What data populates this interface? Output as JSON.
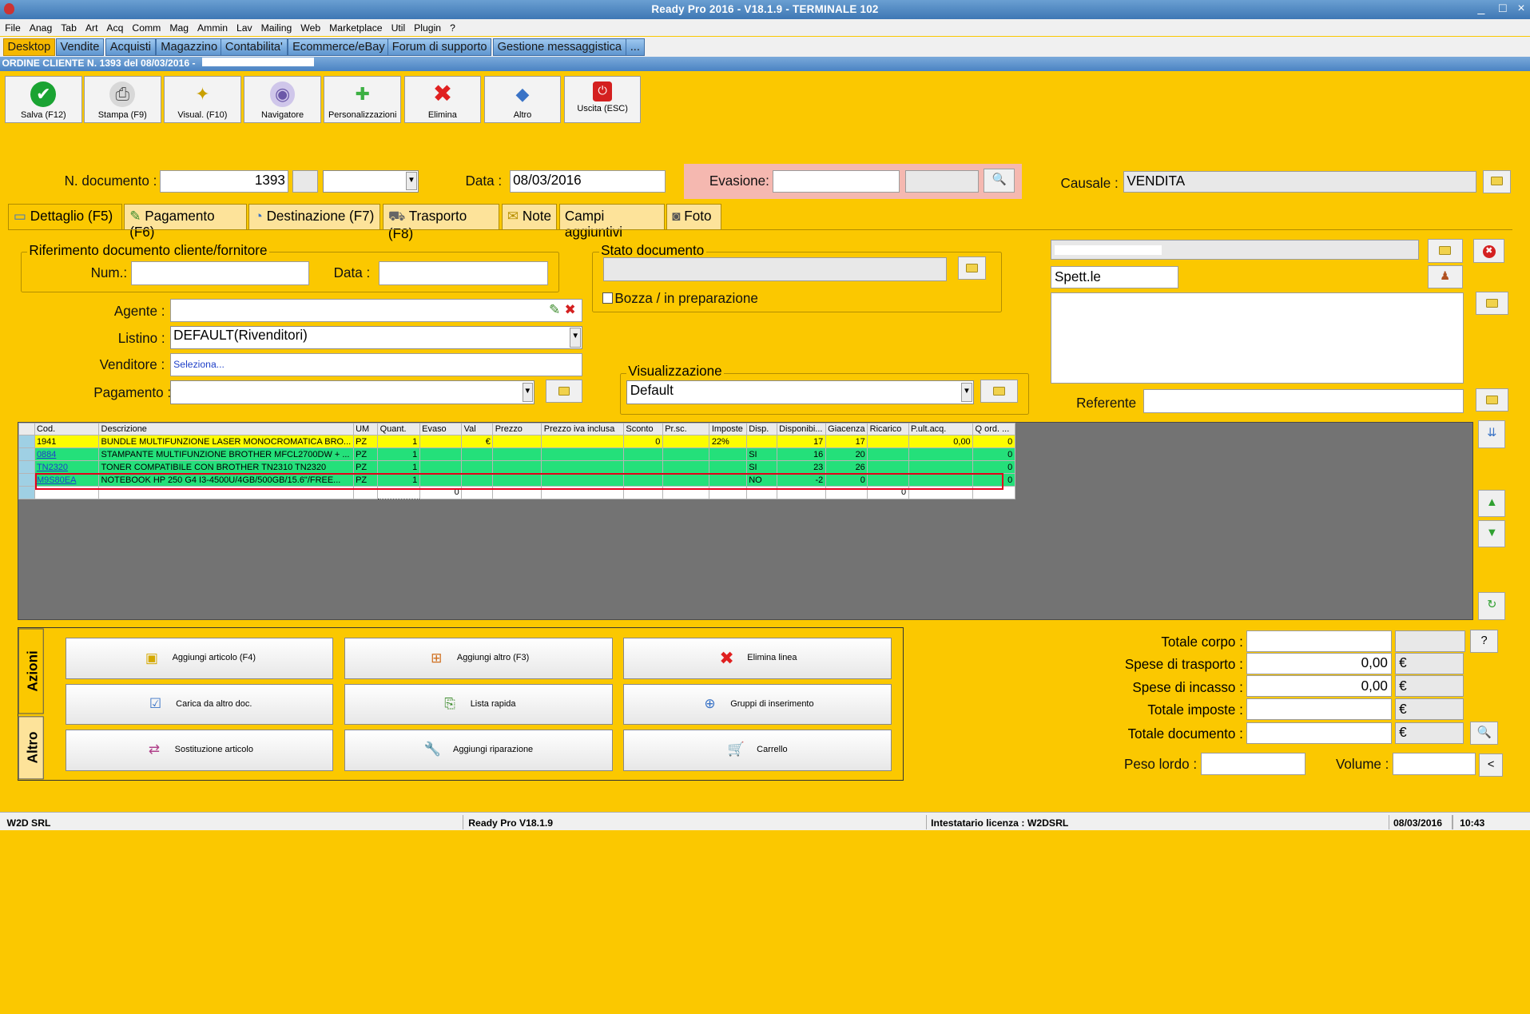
{
  "window": {
    "title": "Ready Pro 2016 - V18.1.9 - TERMINALE 102",
    "min": "_",
    "max": "□",
    "close": "×"
  },
  "menu": [
    "File",
    "Anag",
    "Tab",
    "Art",
    "Acq",
    "Comm",
    "Mag",
    "Ammin",
    "Lav",
    "Mailing",
    "Web",
    "Marketplace",
    "Util",
    "Plugin",
    "?"
  ],
  "main_tabs": [
    "Desktop",
    "Vendite",
    "Acquisti",
    "Magazzino",
    "Contabilita'",
    "Ecommerce/eBay",
    "Forum di supporto",
    "Gestione messaggistica",
    "..."
  ],
  "doc_bar": "ORDINE CLIENTE N. 1393 del 08/03/2016 -",
  "toolbar": [
    {
      "label": "Salva (F12)",
      "icon": "check-icon",
      "color": "#1aa332"
    },
    {
      "label": "Stampa (F9)",
      "icon": "printer-icon",
      "color": "#8a8a8a"
    },
    {
      "label": "Visual. (F10)",
      "icon": "magic-wand-icon",
      "color": "#c9a000"
    },
    {
      "label": "Navigatore",
      "icon": "navigator-icon",
      "color": "#6b58a8"
    },
    {
      "label": "Personalizzazioni",
      "icon": "puzzle-icon",
      "color": "#3cb043"
    },
    {
      "label": "Elimina",
      "icon": "delete-icon",
      "color": "#e02020"
    },
    {
      "label": "Altro",
      "icon": "other-icon",
      "color": "#3a73c6"
    },
    {
      "label": "Uscita (ESC)",
      "icon": "exit-icon",
      "color": "#d42020"
    }
  ],
  "header": {
    "num_label": "N. documento :",
    "num_value": "1393",
    "data_label": "Data :",
    "data_value": "08/03/2016",
    "evasione_label": "Evasione:",
    "evasione_value": "",
    "causale_label": "Causale :",
    "causale_value": "VENDITA"
  },
  "detail_tabs": [
    "Dettaglio (F5)",
    "Pagamento (F6)",
    "Destinazione (F7)",
    "Trasporto (F8)",
    "Note",
    "Campi aggiuntivi",
    "Foto"
  ],
  "rif": {
    "group": "Riferimento documento cliente/fornitore",
    "num_label": "Num.:",
    "data_label": "Data :"
  },
  "stato": {
    "group": "Stato documento",
    "bozza": "Bozza / in preparazione"
  },
  "agente_label": "Agente :",
  "listino_label": "Listino :",
  "listino_value": "DEFAULT(Rivenditori)",
  "venditore_label": "Venditore :",
  "venditore_value": "Seleziona...",
  "pagamento_label": "Pagamento :",
  "visual": {
    "group": "Visualizzazione",
    "value": "Default"
  },
  "cliente": {
    "spett": "Spett.le",
    "referente_label": "Referente"
  },
  "grid": {
    "columns": [
      "Cod.",
      "Descrizione",
      "UM",
      "Quant.",
      "Evaso",
      "Val",
      "Prezzo",
      "Prezzo iva inclusa",
      "Sconto",
      "Pr.sc.",
      "Imposte",
      "Disp.",
      "Disponibi...",
      "Giacenza",
      "Ricarico",
      "P.ult.acq.",
      "Q ord. ..."
    ],
    "rows": [
      {
        "style": "yellow",
        "cells": [
          "1941",
          "BUNDLE MULTIFUNZIONE LASER MONOCROMATICA BRO...",
          "PZ",
          "1",
          "",
          "€",
          "",
          "",
          "0",
          "",
          "22%",
          "",
          "17",
          "17",
          "",
          "0,00",
          "0"
        ]
      },
      {
        "style": "green",
        "cells": [
          "0884",
          "STAMPANTE MULTIFUNZIONE BROTHER MFCL2700DW + ...",
          "PZ",
          "1",
          "",
          "",
          "",
          "",
          "",
          "",
          "",
          "SI",
          "16",
          "20",
          "",
          "",
          "0"
        ]
      },
      {
        "style": "green",
        "cells": [
          "TN2320",
          "TONER COMPATIBILE CON BROTHER TN2310 TN2320",
          "PZ",
          "1",
          "",
          "",
          "",
          "",
          "",
          "",
          "",
          "SI",
          "23",
          "26",
          "",
          "",
          "0"
        ]
      },
      {
        "style": "green",
        "cells": [
          "M9S80EA",
          "NOTEBOOK HP 250 G4 I3-4500U/4GB/500GB/15.6\"/FREE...",
          "PZ",
          "1",
          "",
          "",
          "",
          "",
          "",
          "",
          "",
          "NO",
          "-2",
          "0",
          "",
          "",
          "0"
        ]
      }
    ],
    "empty_row": [
      "",
      "",
      "",
      "",
      "0",
      "",
      "",
      "",
      "",
      "",
      "",
      "",
      "",
      "",
      "0",
      "",
      ""
    ]
  },
  "actions": {
    "tab_azioni": "Azioni",
    "tab_altro": "Altro",
    "buttons": [
      {
        "label": "Aggiungi articolo (F4)",
        "icon": "box-add-icon"
      },
      {
        "label": "Aggiungi altro (F3)",
        "icon": "grid-add-icon"
      },
      {
        "label": "Elimina linea",
        "icon": "delete-line-icon"
      },
      {
        "label": "Carica da altro doc.",
        "icon": "load-doc-icon"
      },
      {
        "label": "Lista rapida",
        "icon": "quick-list-icon"
      },
      {
        "label": "Gruppi di inserimento",
        "icon": "insert-groups-icon"
      },
      {
        "label": "Sostituzione articolo",
        "icon": "replace-item-icon"
      },
      {
        "label": "Aggiungi riparazione",
        "icon": "wrench-icon"
      },
      {
        "label": "Carrello",
        "icon": "cart-icon"
      }
    ]
  },
  "totals": {
    "corpo_label": "Totale corpo :",
    "corpo_value": "",
    "trasporto_label": "Spese di trasporto :",
    "trasporto_value": "0,00",
    "incasso_label": "Spese di incasso :",
    "incasso_value": "0,00",
    "imposte_label": "Totale imposte :",
    "imposte_value": "",
    "documento_label": "Totale documento :",
    "documento_value": "",
    "currency": "€",
    "help": "?",
    "peso_label": "Peso lordo :",
    "volume_label": "Volume :",
    "back": "<"
  },
  "status": {
    "company": "W2D SRL",
    "app": "Ready Pro V18.1.9",
    "licensee": "Intestatario licenza : W2DSRL",
    "date": "08/03/2016",
    "time": "10:43"
  }
}
